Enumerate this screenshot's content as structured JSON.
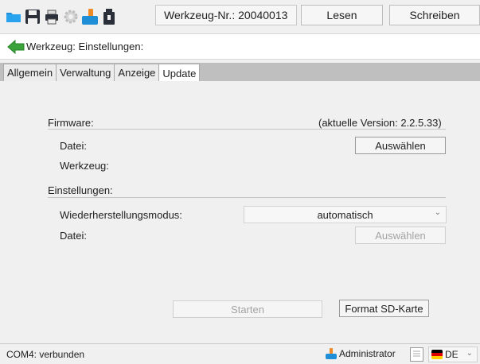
{
  "toolbar": {
    "icons": [
      "folder-icon",
      "save-icon",
      "printer-icon",
      "gear-icon",
      "user-tool-icon",
      "usb-device-icon"
    ],
    "title": "Werkzeug-Nr.: 20040013",
    "read_label": "Lesen",
    "write_label": "Schreiben"
  },
  "subheader": {
    "back_icon": "back-arrow-icon",
    "title": "Werkzeug: Einstellungen:"
  },
  "tabs": [
    {
      "label": "Allgemein",
      "active": false
    },
    {
      "label": "Verwaltung",
      "active": false
    },
    {
      "label": "Anzeige",
      "active": false
    },
    {
      "label": "Update",
      "active": true
    }
  ],
  "firmware": {
    "section_label": "Firmware:",
    "current_version": "(aktuelle Version:  2.2.5.33)",
    "file_label": "Datei:",
    "select_label": "Auswählen",
    "tool_label": "Werkzeug:"
  },
  "settings": {
    "section_label": "Einstellungen:",
    "restore_mode_label": "Wiederherstellungsmodus:",
    "restore_mode_value": "automatisch",
    "file_label": "Datei:",
    "select_label": "Auswählen"
  },
  "actions": {
    "start_label": "Starten",
    "format_label": "Format SD-Karte"
  },
  "status": {
    "connection": "COM4: verbunden",
    "user": "Administrator",
    "language": "DE"
  },
  "colors": {
    "tab_strip": "#bfbfbf",
    "accent_orange": "#f08a24",
    "folder_blue": "#1e8fd6"
  }
}
